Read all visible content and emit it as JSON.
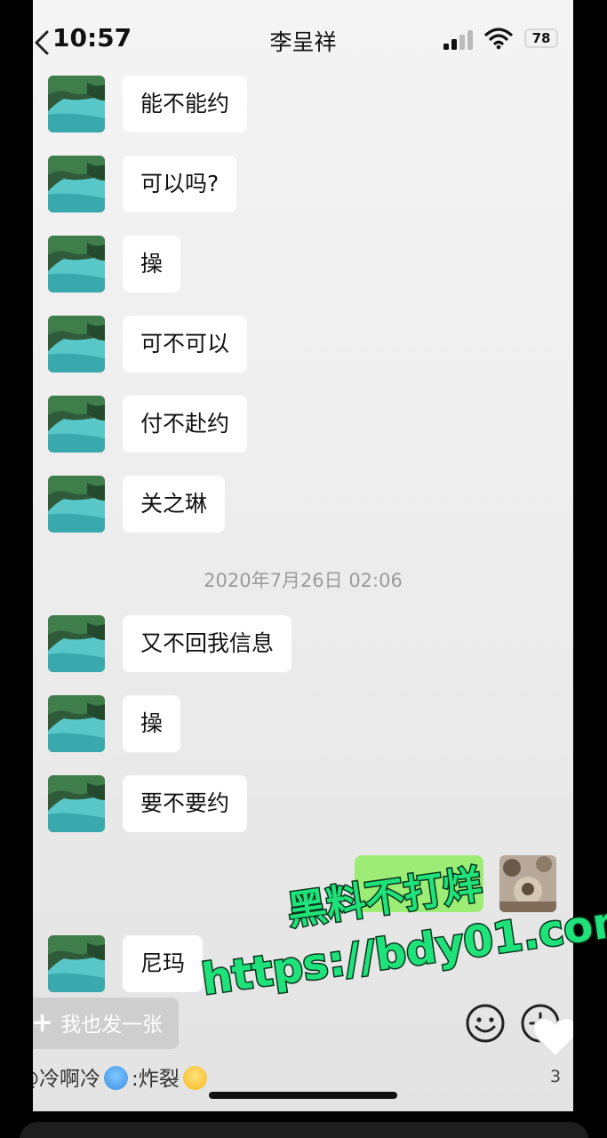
{
  "status_bar": {
    "time": "10:57",
    "contact_name": "李呈祥",
    "battery": "78"
  },
  "messages_before": [
    {
      "text": "能不能约"
    },
    {
      "text": "可以吗?"
    },
    {
      "text": "操"
    },
    {
      "text": "可不可以"
    },
    {
      "text": "付不赴约"
    },
    {
      "text": "关之琳"
    }
  ],
  "timestamp": "2020年7月26日 02:06",
  "messages_after": [
    {
      "text": "又不回我信息"
    },
    {
      "text": "操"
    },
    {
      "text": "要不要约"
    },
    {
      "text": "尼玛"
    }
  ],
  "watermark": {
    "line1": "黑料不打烊",
    "line2": "https://bdy01.com"
  },
  "bottom": {
    "post_button": "我也发一张",
    "comment_user": "@冷啊冷",
    "comment_text": ":炸裂",
    "like_count": "3"
  },
  "icons": {
    "back": "chevron-left-icon",
    "signal": "signal-icon",
    "wifi": "wifi-icon",
    "emoji": "emoji-icon",
    "plus": "plus-circle-icon",
    "heart": "heart-icon"
  },
  "colors": {
    "sent_bubble": "#95ec69",
    "watermark_fill": "#1fe27a",
    "chat_background": "#ededed"
  }
}
